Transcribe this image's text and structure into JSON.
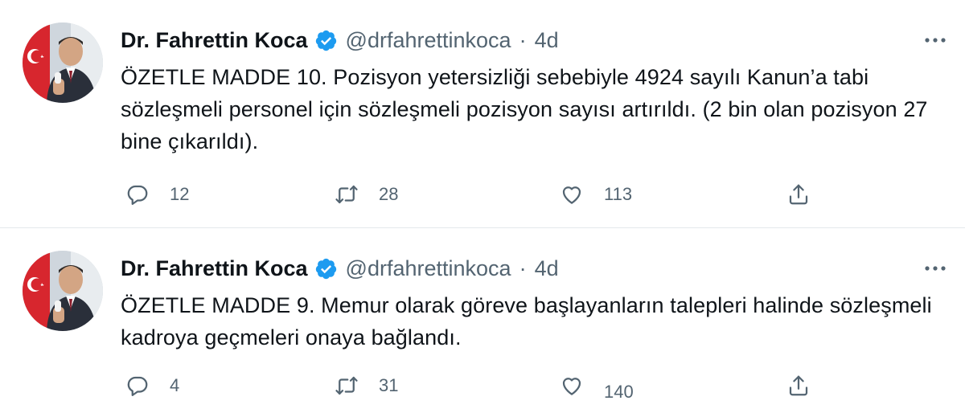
{
  "tweets": [
    {
      "author": "Dr. Fahrettin Koca",
      "handle": "@drfahrettinkoca",
      "separator": "·",
      "time": "4d",
      "text": "ÖZETLE MADDE 10. Pozisyon yetersizliği sebebiyle 4924 sayılı Kanun’a tabi sözleşmeli personel için sözleşmeli pozisyon sayısı artırıldı. (2 bin olan pozisyon 27 bine çıkarıldı).",
      "replies": "12",
      "retweets": "28",
      "likes": "113"
    },
    {
      "author": "Dr. Fahrettin Koca",
      "handle": "@drfahrettinkoca",
      "separator": "·",
      "time": "4d",
      "text": "ÖZETLE MADDE 9. Memur olarak göreve başlayanların talepleri halinde sözleşmeli kadroya geçmeleri onaya bağlandı.",
      "replies": "4",
      "retweets": "31",
      "likes": "140"
    }
  ],
  "icons": {
    "verified": "verified-badge-icon",
    "more": "more-icon",
    "reply": "reply-icon",
    "retweet": "retweet-icon",
    "like": "like-icon",
    "share": "share-icon"
  },
  "colors": {
    "verified": "#1d9bf0",
    "text": "#0f1419",
    "muted": "#536471",
    "divider": "#e4e8eb"
  }
}
